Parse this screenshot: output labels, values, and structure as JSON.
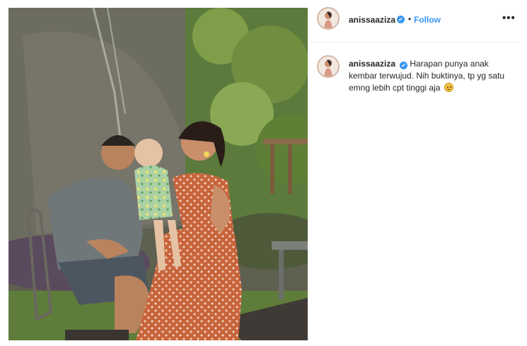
{
  "post": {
    "username": "anissaaziza",
    "verified": true,
    "follow_label": "Follow",
    "separator": "•",
    "more_label": "•••",
    "verified_mark": "✔",
    "caption": "Harapan punya anak kembar terwujud. Nih buktinya, tp yg satu emng lebih cpt tinggi aja"
  },
  "colors": {
    "accent": "#3897f0",
    "text": "#262626",
    "divider": "#efefef"
  },
  "icons": {
    "verified": "verified-badge-icon",
    "more": "more-options-icon",
    "emoji": "smiling-face-emoji"
  }
}
